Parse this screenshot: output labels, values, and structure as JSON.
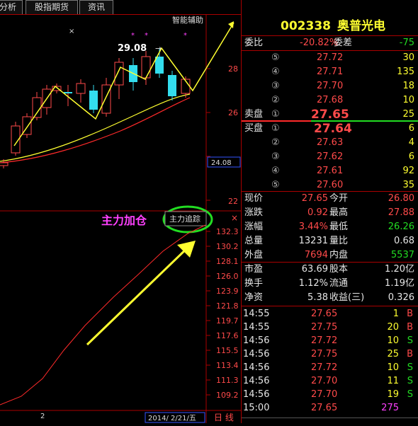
{
  "tabs": [
    "分析",
    "股指期货",
    "资讯"
  ],
  "chart": {
    "assist_label": "智能辅助",
    "peak_label": "29.08",
    "price_axis": [
      "28",
      "26",
      "24.08",
      "22"
    ],
    "lower_title": "主力加仓",
    "tracking_button": "主力追踪",
    "lower_axis": [
      "132.3",
      "130.2",
      "128.1",
      "126.0",
      "123.9",
      "121.8",
      "119.7",
      "117.6",
      "115.5",
      "113.4",
      "111.3",
      "109.2"
    ],
    "x_label": "2",
    "date_label": "2014/ 2/21/五",
    "period_label": "日 线"
  },
  "quote": {
    "code": "002338",
    "name": "奥普光电",
    "weibi_label": "委比",
    "weibi_value": "-20.82%",
    "weicha_label": "委差",
    "weicha_value": "-75",
    "sell_label": "卖盘",
    "buy_label": "买盘",
    "asks": [
      {
        "lvl": "⑤",
        "price": "27.72",
        "vol": "30"
      },
      {
        "lvl": "④",
        "price": "27.71",
        "vol": "135"
      },
      {
        "lvl": "③",
        "price": "27.70",
        "vol": "18"
      },
      {
        "lvl": "②",
        "price": "27.68",
        "vol": "10"
      },
      {
        "lvl": "①",
        "price": "27.65",
        "vol": "25"
      }
    ],
    "bids": [
      {
        "lvl": "①",
        "price": "27.64",
        "vol": "6"
      },
      {
        "lvl": "②",
        "price": "27.63",
        "vol": "4"
      },
      {
        "lvl": "③",
        "price": "27.62",
        "vol": "6"
      },
      {
        "lvl": "④",
        "price": "27.61",
        "vol": "92"
      },
      {
        "lvl": "⑤",
        "price": "27.60",
        "vol": "35"
      }
    ],
    "stats": [
      {
        "l1": "现价",
        "v1": "27.65",
        "c1": "red",
        "l2": "今开",
        "v2": "26.80",
        "c2": "red"
      },
      {
        "l1": "涨跌",
        "v1": "0.92",
        "c1": "red",
        "l2": "最高",
        "v2": "27.88",
        "c2": "red"
      },
      {
        "l1": "涨幅",
        "v1": "3.44%",
        "c1": "red",
        "l2": "最低",
        "v2": "26.26",
        "c2": "green"
      },
      {
        "l1": "总量",
        "v1": "13231",
        "c1": "white",
        "l2": "量比",
        "v2": "0.68",
        "c2": "white"
      },
      {
        "l1": "外盘",
        "v1": "7694",
        "c1": "red",
        "l2": "内盘",
        "v2": "5537",
        "c2": "green"
      }
    ],
    "fundamentals": [
      {
        "l1": "市盈",
        "v1": "63.69",
        "l2": "股本",
        "v2": "1.20亿"
      },
      {
        "l1": "换手",
        "v1": "1.12%",
        "l2": "流通",
        "v2": "1.19亿"
      },
      {
        "l1": "净资",
        "v1": "5.38",
        "l2": "收益(三)",
        "v2": "0.326"
      }
    ],
    "ticks": [
      {
        "time": "14:55",
        "price": "27.65",
        "vol": "1",
        "side": "B"
      },
      {
        "time": "14:55",
        "price": "27.75",
        "vol": "20",
        "side": "B"
      },
      {
        "time": "14:56",
        "price": "27.72",
        "vol": "10",
        "side": "S"
      },
      {
        "time": "14:56",
        "price": "27.75",
        "vol": "25",
        "side": "B"
      },
      {
        "time": "14:56",
        "price": "27.72",
        "vol": "10",
        "side": "S"
      },
      {
        "time": "14:56",
        "price": "27.70",
        "vol": "11",
        "side": "S"
      },
      {
        "time": "14:56",
        "price": "27.70",
        "vol": "19",
        "side": "S"
      },
      {
        "time": "15:00",
        "price": "27.65",
        "vol": "275",
        "side": ""
      }
    ],
    "colors": {
      "up": "#ff4a4a",
      "down": "#22dd22",
      "volume": "#ff40ff",
      "border": "#aa0000"
    }
  }
}
